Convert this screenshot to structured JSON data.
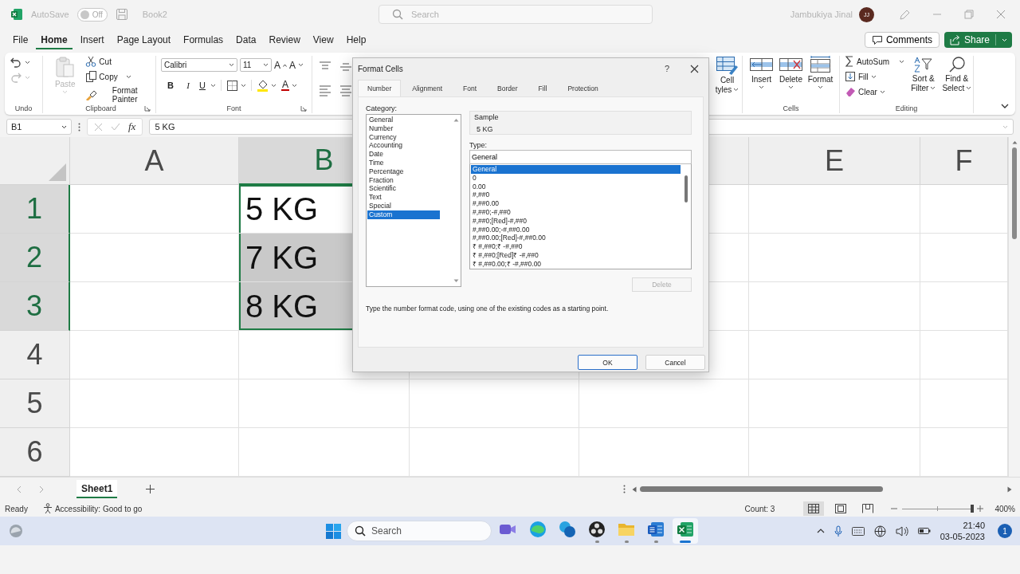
{
  "title_bar": {
    "autosave": {
      "label": "AutoSave",
      "on": false,
      "state_text": "Off"
    },
    "document_name": "Book2",
    "search": {
      "placeholder": "Search"
    },
    "user": {
      "name": "Jambukiya Jinal",
      "initials": "JJ"
    }
  },
  "menu_tabs": [
    {
      "label": "File",
      "selected": false
    },
    {
      "label": "Home",
      "selected": true
    },
    {
      "label": "Insert",
      "selected": false
    },
    {
      "label": "Page Layout",
      "selected": false
    },
    {
      "label": "Formulas",
      "selected": false
    },
    {
      "label": "Data",
      "selected": false
    },
    {
      "label": "Review",
      "selected": false
    },
    {
      "label": "View",
      "selected": false
    },
    {
      "label": "Help",
      "selected": false
    }
  ],
  "header_buttons": {
    "comments": "Comments",
    "share": "Share"
  },
  "ribbon": {
    "undo": {
      "caption": "Undo"
    },
    "clipboard": {
      "paste": "Paste",
      "cut": "Cut",
      "copy": "Copy",
      "format_painter": "Format Painter",
      "caption": "Clipboard"
    },
    "font": {
      "font_name": "Calibri",
      "font_size": "11",
      "grow": "A",
      "shrink": "A",
      "bold": "B",
      "italic": "I",
      "underline": "U",
      "font_color": "A",
      "caption": "Font"
    },
    "styles": {
      "cell_styles": [
        "Cell",
        "tyles"
      ]
    },
    "cells": {
      "buttons": [
        "Insert",
        "Delete",
        "Format"
      ],
      "caption": "Cells"
    },
    "editing": {
      "autosum": "AutoSum",
      "fill": "Fill",
      "clear": "Clear",
      "sort_filter": [
        "Sort &",
        "Filter"
      ],
      "find_select": [
        "Find &",
        "Select"
      ],
      "caption": "Editing"
    }
  },
  "formula_bar": {
    "name_box": "B1",
    "function_label": "fx",
    "value": "5 KG"
  },
  "grid": {
    "columns": [
      {
        "label": "A",
        "selected": false
      },
      {
        "label": "B",
        "selected": true
      },
      {},
      {},
      {
        "label": "E",
        "selected": false
      },
      {
        "label": "F",
        "selected": false
      }
    ],
    "rows": [
      {
        "label": "1",
        "selected": true,
        "active": true,
        "value": "5 KG"
      },
      {
        "label": "2",
        "selected": true,
        "active": false,
        "value": "7 KG"
      },
      {
        "label": "3",
        "selected": true,
        "active": false,
        "value": "8 KG"
      },
      {
        "label": "4",
        "selected": false
      },
      {
        "label": "5",
        "selected": false
      },
      {
        "label": "6",
        "selected": false
      }
    ]
  },
  "sheet_tabs": [
    {
      "label": "Sheet1",
      "selected": true
    }
  ],
  "status_bar": {
    "mode": "Ready",
    "accessibility": "Accessibility: Good to go",
    "count": "Count: 3",
    "views": [
      {
        "kind": "normal",
        "selected": true
      },
      {
        "kind": "page_layout",
        "selected": false
      },
      {
        "kind": "page_break",
        "selected": false
      }
    ],
    "zoom": {
      "level": 1,
      "reading": "400%"
    }
  },
  "dialog": {
    "title": "Format Cells",
    "help": "?",
    "tabs": [
      {
        "label": "Number",
        "selected": true
      },
      {
        "label": "Alignment",
        "selected": false
      },
      {
        "label": "Font",
        "selected": false
      },
      {
        "label": "Border",
        "selected": false
      },
      {
        "label": "Fill",
        "selected": false
      },
      {
        "label": "Protection",
        "selected": false
      }
    ],
    "category_label": "Category:",
    "categories": [
      {
        "label": "General",
        "selected": false
      },
      {
        "label": "Number",
        "selected": false
      },
      {
        "label": "Currency",
        "selected": false
      },
      {
        "label": "Accounting",
        "selected": false
      },
      {
        "label": "Date",
        "selected": false
      },
      {
        "label": "Time",
        "selected": false
      },
      {
        "label": "Percentage",
        "selected": false
      },
      {
        "label": "Fraction",
        "selected": false
      },
      {
        "label": "Scientific",
        "selected": false
      },
      {
        "label": "Text",
        "selected": false
      },
      {
        "label": "Special",
        "selected": false
      },
      {
        "label": "Custom",
        "selected": true
      }
    ],
    "sample_label": "Sample",
    "sample": "5 KG",
    "type_label": "Type:",
    "type_value": "General",
    "formats": [
      {
        "label": "General",
        "selected": true
      },
      {
        "label": "0",
        "selected": false
      },
      {
        "label": "0.00",
        "selected": false
      },
      {
        "label": "#,##0",
        "selected": false
      },
      {
        "label": "#,##0.00",
        "selected": false
      },
      {
        "label": "#,##0;-#,##0",
        "selected": false
      },
      {
        "label": "#,##0;[Red]-#,##0",
        "selected": false
      },
      {
        "label": "#,##0.00;-#,##0.00",
        "selected": false
      },
      {
        "label": "#,##0.00;[Red]-#,##0.00",
        "selected": false
      },
      {
        "label": "₹ #,##0;₹ -#,##0",
        "selected": false
      },
      {
        "label": "₹ #,##0;[Red]₹ -#,##0",
        "selected": false
      },
      {
        "label": "₹ #,##0.00;₹ -#,##0.00",
        "selected": false
      }
    ],
    "delete": {
      "label": "Delete",
      "disabled": true
    },
    "description": "Type the number format code, using one of the existing codes as a starting point.",
    "ok": "OK",
    "cancel": "Cancel"
  },
  "taskbar": {
    "search": {
      "placeholder": "Search"
    },
    "apps": [
      {
        "kind": "meet",
        "running": false,
        "selected": false
      },
      {
        "kind": "edge",
        "running": false,
        "selected": false
      },
      {
        "kind": "help",
        "running": false,
        "selected": false
      },
      {
        "kind": "obs",
        "running": true,
        "selected": false
      },
      {
        "kind": "explorer",
        "running": true,
        "selected": false
      },
      {
        "kind": "word",
        "running": true,
        "selected": false
      },
      {
        "kind": "excel",
        "running": true,
        "selected": true
      }
    ],
    "time": "21:40",
    "date": "03-05-2023",
    "notification_count": "1"
  }
}
